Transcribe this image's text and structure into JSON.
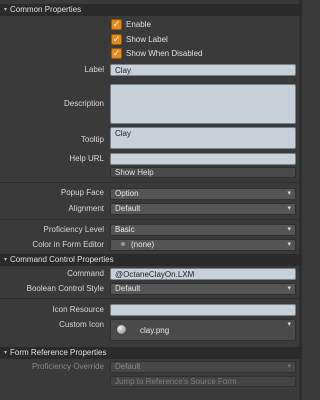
{
  "common": {
    "header": "Common Properties",
    "enable_label": "Enable",
    "show_label_label": "Show Label",
    "show_when_disabled_label": "Show When Disabled",
    "check_glyph": "✓",
    "label_label": "Label",
    "label_value": "Clay",
    "description_label": "Description",
    "description_value": "",
    "tooltip_label": "Tooltip",
    "tooltip_value": "Clay",
    "help_url_label": "Help URL",
    "help_url_value": "",
    "show_help_label": "Show Help",
    "popup_face_label": "Popup Face",
    "popup_face_value": "Option",
    "alignment_label": "Alignment",
    "alignment_value": "Default",
    "proficiency_label": "Proficiency Level",
    "proficiency_value": "Basic",
    "color_label": "Color in Form Editor",
    "color_value": "(none)"
  },
  "command": {
    "header": "Command Control Properties",
    "command_label": "Command",
    "command_value": "@OctaneClayOn.LXM",
    "boolean_label": "Boolean Control Style",
    "boolean_value": "Default",
    "icon_resource_label": "Icon Resource",
    "icon_resource_value": "",
    "custom_icon_label": "Custom Icon",
    "custom_icon_value": "clay.png"
  },
  "form_ref": {
    "header": "Form Reference Properties",
    "override_label": "Proficiency Override",
    "override_value": "Default",
    "jump_label": "Jump to Reference's Source Form"
  },
  "icons": {
    "triangle": "▾",
    "dropdown": "▾"
  },
  "colors": {
    "accent_checkbox": "#e48a20",
    "field_bg": "#c8d0da"
  }
}
